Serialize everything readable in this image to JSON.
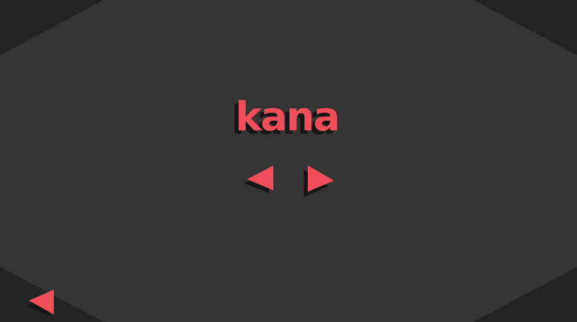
{
  "game": {
    "title": "kana"
  },
  "colors": {
    "background_outer": "#232323",
    "background_inner": "#353535",
    "accent": "#f04e5b",
    "shadow": "#161616"
  },
  "controls": {
    "prev_icon": "triangle-left-icon",
    "next_icon": "triangle-right-icon",
    "back_icon": "triangle-left-icon"
  }
}
